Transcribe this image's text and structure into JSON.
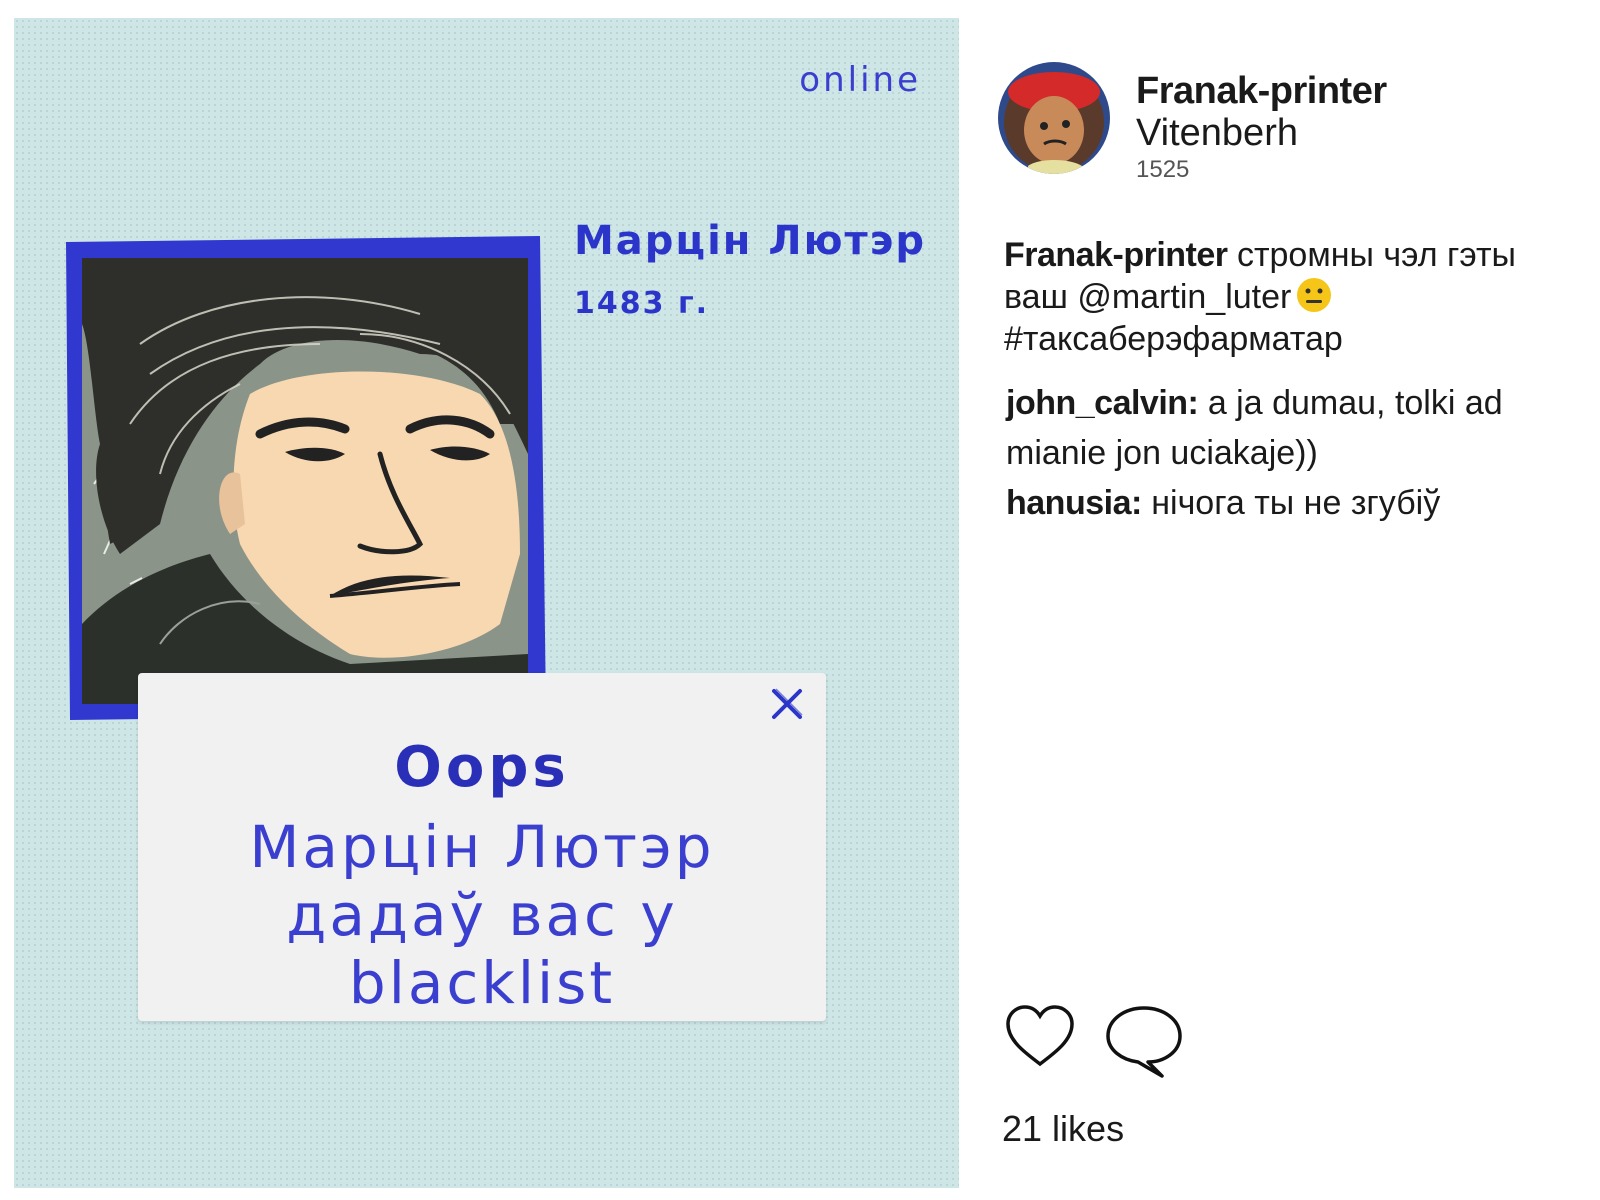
{
  "post_image": {
    "status": "online",
    "profile_name": "Марцін Лютэр",
    "profile_year": "1483 г.",
    "popup": {
      "title": "Oops",
      "message": "Марцін Лютэр дадаў вас у blacklist"
    }
  },
  "author": {
    "username": "Franak-printer",
    "location": "Vitenberh",
    "date": "1525"
  },
  "caption": {
    "username": "Franak-printer",
    "text_part1": "стромны чэл гэты ваш @martin_luter",
    "emoji": "neutral-face-emoji",
    "hashtag": "#таксаберэфарматар"
  },
  "comments": [
    {
      "user": "john_calvin:",
      "text": "a ja dumau, tolki ad mianie jon uciakaje))"
    },
    {
      "user": "hanusia:",
      "text": "нічога ты не згубіў"
    }
  ],
  "actions": {
    "like_icon": "heart-outline-icon",
    "comment_icon": "speech-bubble-icon"
  },
  "likes": "21 likes",
  "colors": {
    "accent_blue": "#2c35c9",
    "image_background": "#cfe6e6",
    "popup_background": "#f1f1f1"
  }
}
